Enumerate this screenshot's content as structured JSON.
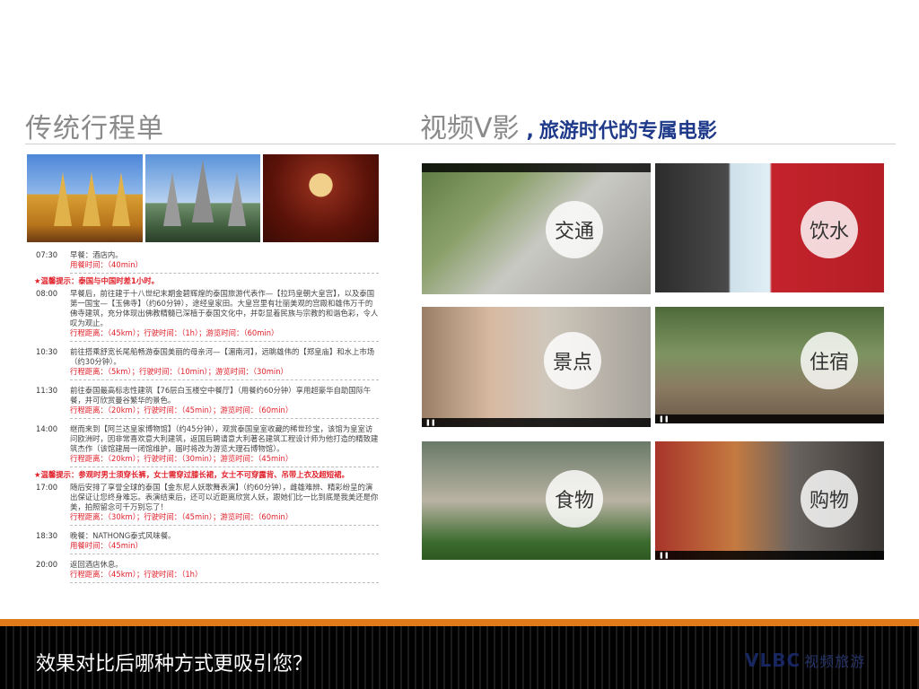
{
  "left_title": "传统行程单",
  "right_title": {
    "main": "视频V影",
    "sep": ",",
    "sub": "旅游时代的专属电影"
  },
  "itinerary": [
    {
      "time": "07:30",
      "desc": "早餐：酒店内。",
      "meta": "用餐时间：（40min）"
    },
    {
      "tip": "★温馨提示：泰国与中国时差1小时。"
    },
    {
      "time": "08:00",
      "desc": "早餐后，前往建于十八世纪末期金碧辉煌的泰国旅游代表作—【拉玛皇朝大皇宫】，以及泰国第一国宝—【玉佛寺】（约60分钟），途经皇家田。大皇宫里有壮丽美观的宫殿和雄伟万千的佛寺建筑，充分体现出佛教精髓已深植于泰国文化中，并彰显着民族与宗教的和谐色彩，令人叹为观止。",
      "meta": "行程距离：（45km）；行驶时间：（1h）；游览时间：（60min）"
    },
    {
      "time": "10:30",
      "desc": "前往搭乘舒宽长尾船畅游泰国美丽的母亲河—【湄南河】，远眺雄伟的【郑皇庙】和水上市场（约30分钟）。",
      "meta": "行程距离：（5km）；行驶时间：（10min）；游览时间：（30min）"
    },
    {
      "time": "11:30",
      "desc": "前往泰国最高标志性建筑【76层白玉楼空中餐厅】（用餐约60分钟）享用超豪华自助国际午餐，并可欣赏曼谷繁华的景色。",
      "meta": "行程距离：（20km）；行驶时间：（45min）；游览时间：（60min）"
    },
    {
      "time": "14:00",
      "desc": "继而来到【阿兰达皇家博物馆】（约45分钟），观赏泰国皇室收藏的稀世珍宝，该馆为皇室访问欧洲时，因非常喜欢意大利建筑，返国后聘请意大利著名建筑工程设计师为他打造的精致建筑杰作（该馆建局一闭馆维护，届时将改为游览大理石博物馆）。",
      "meta": "行程距离：（20km）；行驶时间：（30min）；游览时间：（45min）"
    },
    {
      "tip": "★温馨提示：参观时男士须穿长裤，女士需穿过膝长裙，女士不可穿露背、吊带上衣及超短裙。"
    },
    {
      "time": "17:00",
      "desc": "随后安排了享誉全球的泰国【金东尼人妖歌舞表演】（约60分钟），雌雄难辨、精彩纷呈的演出保证让您终身难忘。表演结束后，还可以近距离欣赏人妖，跟她们比一比到底是我美还是你美，拍照留念可千万别忘了！",
      "meta": "行程距离：（30km）；行驶时间：（45min）；游览时间：（60min）"
    },
    {
      "time": "18:30",
      "desc": "晚餐：NATHONG泰式风味餐。",
      "meta": "用餐时间：（45min）"
    },
    {
      "time": "20:00",
      "desc": "返回酒店休息。",
      "meta": "行程距离：（45km）；行驶时间：（1h）"
    }
  ],
  "video_tiles": [
    {
      "label": "交通"
    },
    {
      "label": "饮水"
    },
    {
      "label": "景点"
    },
    {
      "label": "住宿"
    },
    {
      "label": "食物"
    },
    {
      "label": "购物"
    }
  ],
  "footer": {
    "question": "效果对比后哪种方式更吸引您？",
    "logo": "VLBC",
    "logo_tail": "视频旅游"
  },
  "colors": {
    "accent_orange": "#e07b1c",
    "title_blue": "#1f3a8a",
    "tip_red": "#e0202a"
  }
}
